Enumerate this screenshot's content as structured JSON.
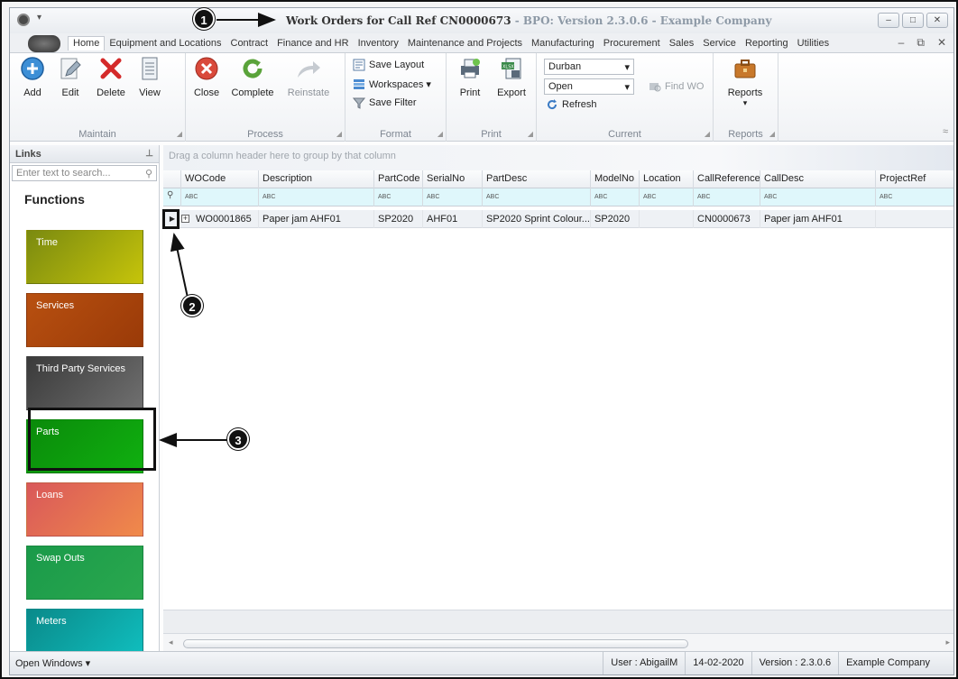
{
  "window": {
    "title_main": "Work Orders for Call Ref CN0000673",
    "title_sub": " - BPO: Version 2.3.0.6 - Example Company",
    "buttons": [
      "minimize-button",
      "restore-button",
      "close-button"
    ],
    "button_glyphs": [
      "–",
      "□",
      "✕"
    ]
  },
  "menu": {
    "items": [
      "Home",
      "Equipment and Locations",
      "Contract",
      "Finance and HR",
      "Inventory",
      "Maintenance and Projects",
      "Manufacturing",
      "Procurement",
      "Sales",
      "Service",
      "Reporting",
      "Utilities"
    ],
    "active": "Home",
    "right_glyphs": [
      "–",
      "⧉",
      "✕"
    ]
  },
  "ribbon": {
    "maintain": {
      "label": "Maintain",
      "add": "Add",
      "edit": "Edit",
      "delete": "Delete",
      "view": "View"
    },
    "process": {
      "label": "Process",
      "close": "Close",
      "complete": "Complete",
      "reinstate": "Reinstate"
    },
    "format": {
      "label": "Format",
      "save_layout": "Save Layout",
      "workspaces": "Workspaces ▾",
      "save_filter": "Save Filter"
    },
    "print": {
      "label": "Print",
      "print": "Print",
      "export": "Export"
    },
    "current": {
      "label": "Current",
      "site": "Durban",
      "status": "Open",
      "refresh": "Refresh",
      "find_wo": "Find WO"
    },
    "reports": {
      "label": "Reports",
      "reports": "Reports"
    },
    "collapse_glyph": "≈"
  },
  "links": {
    "title": "Links",
    "pin_glyph": "⊥",
    "search_placeholder": "Enter text to search...",
    "search_glyph": "⚲",
    "functions_title": "Functions",
    "tiles": [
      {
        "label": "Time",
        "color": "#8a9a0d"
      },
      {
        "label": "Services",
        "color": "#b84a10"
      },
      {
        "label": "Third Party Services",
        "color": "#4b4b4b"
      },
      {
        "label": "Parts",
        "color": "#0a9a0a"
      },
      {
        "label": "Loans",
        "color": "#e36c4e"
      },
      {
        "label": "Swap Outs",
        "color": "#1f9a4e"
      },
      {
        "label": "Meters",
        "color": "#0aa3a3"
      }
    ]
  },
  "grid": {
    "group_panel_text": "Drag a column header here to group by that column",
    "columns": [
      "WOCode",
      "Description",
      "PartCode",
      "SerialNo",
      "PartDesc",
      "ModelNo",
      "Location",
      "CallReference",
      "CallDesc",
      "ProjectRef"
    ],
    "filter_glyph": "ABC",
    "filter_pin_glyph": "⚲",
    "row_indicator_glyph": "▶",
    "expander_glyph": "+",
    "rows": [
      {
        "WOCode": "WO0001865",
        "Description": "Paper jam AHF01",
        "PartCode": "SP2020",
        "SerialNo": "AHF01",
        "PartDesc": "SP2020 Sprint Colour...",
        "ModelNo": "SP2020",
        "Location": "",
        "CallReference": "CN0000673",
        "CallDesc": "Paper jam AHF01",
        "ProjectRef": ""
      }
    ],
    "scroll_left": "◂",
    "scroll_right": "▸"
  },
  "statusbar": {
    "open_windows": "Open Windows ▾",
    "user": "User : AbigailM",
    "date": "14-02-2020",
    "version": "Version : 2.3.0.6",
    "company": "Example Company"
  },
  "callouts": [
    "1",
    "2",
    "3"
  ]
}
